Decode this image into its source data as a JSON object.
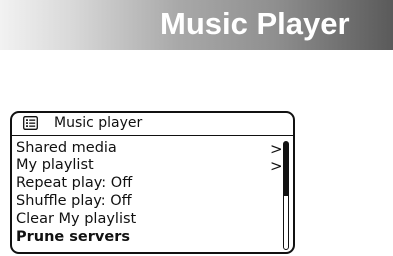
{
  "banner": {
    "title": "Music Player"
  },
  "screen": {
    "header": {
      "icon": "menu-list-icon",
      "title": "Music player"
    },
    "items": [
      {
        "label": "Shared media",
        "arrow": ">"
      },
      {
        "label": "My playlist",
        "arrow": ">"
      },
      {
        "label": "Repeat play: Off"
      },
      {
        "label": "Shuffle play: Off"
      },
      {
        "label": "Clear My playlist"
      },
      {
        "label": "Prune servers"
      }
    ],
    "scrollbar": {
      "position": 0,
      "visible_fraction": 0.5
    }
  }
}
